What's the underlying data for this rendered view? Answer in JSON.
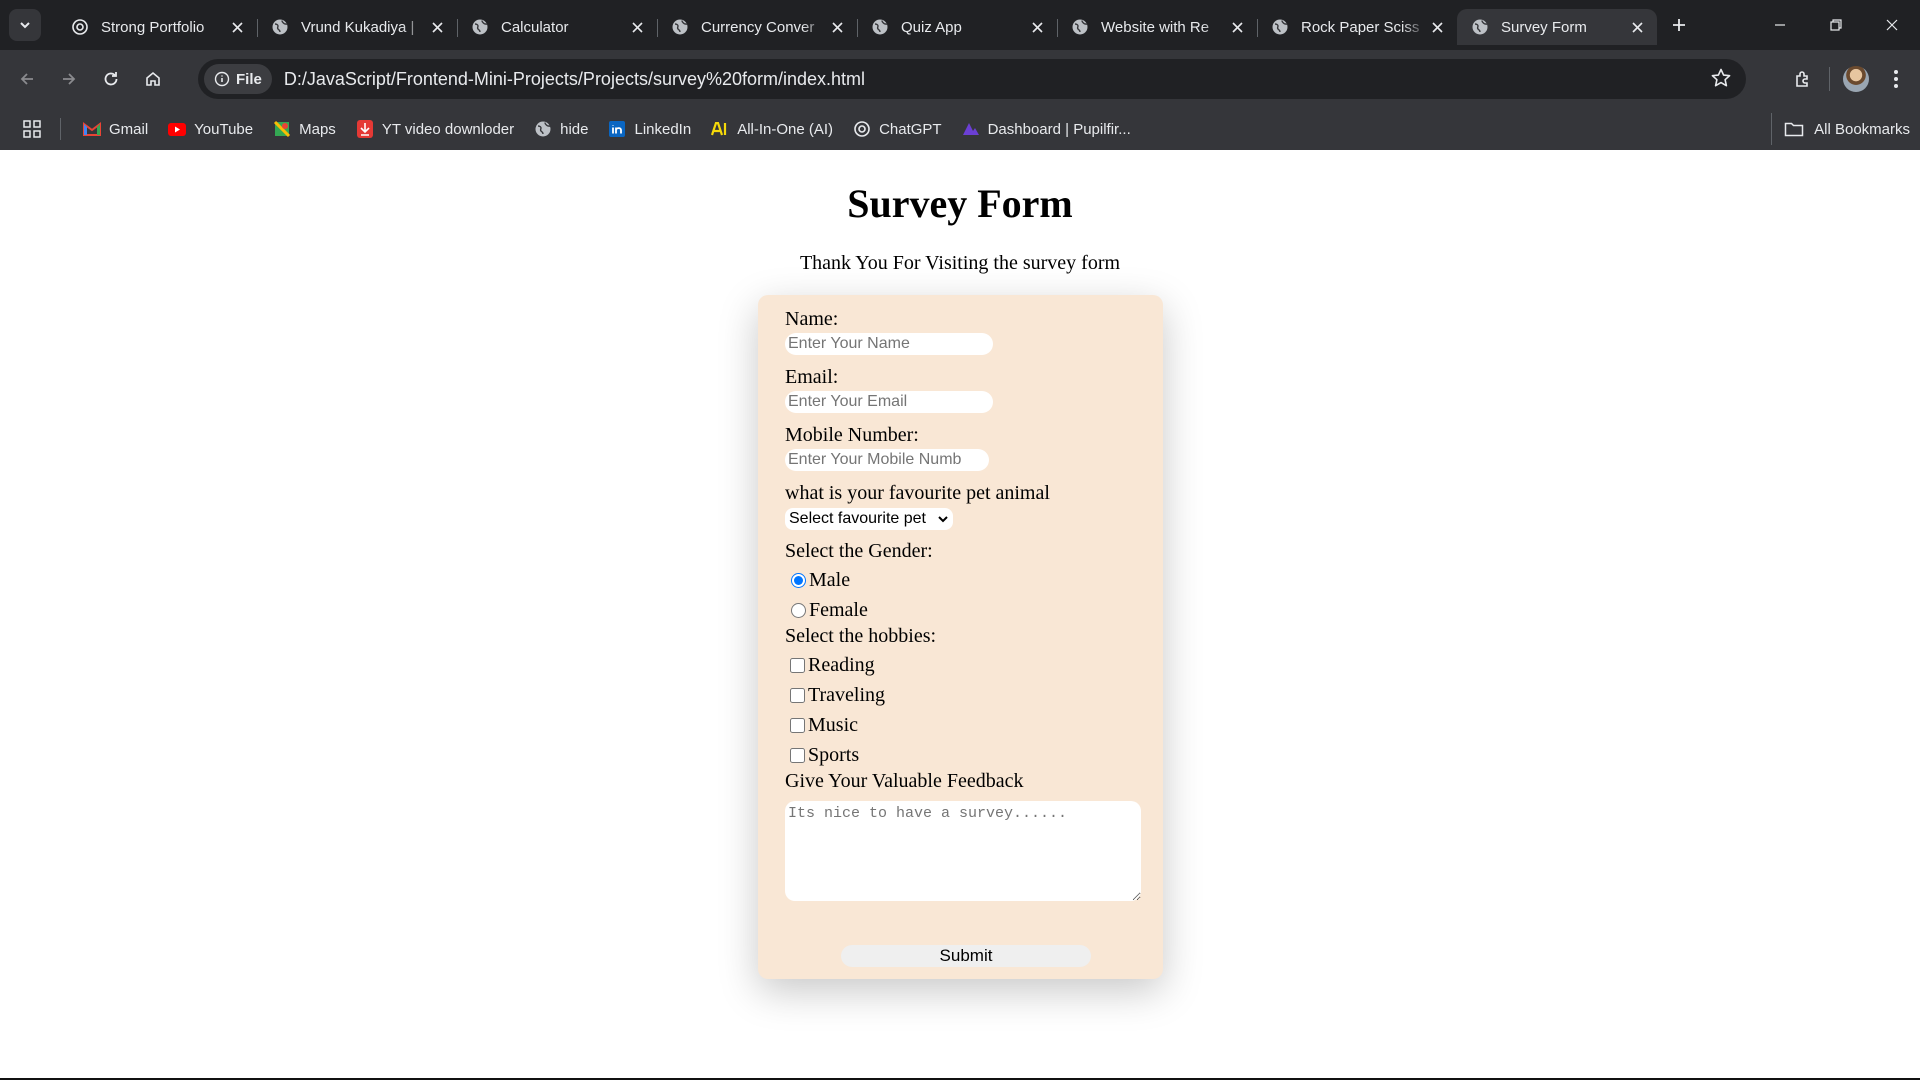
{
  "browser": {
    "tabs": [
      {
        "title": "Strong Portfolio",
        "icon": "openai-icon"
      },
      {
        "title": "Vrund Kukadiya |",
        "icon": "globe-icon"
      },
      {
        "title": "Calculator",
        "icon": "globe-icon"
      },
      {
        "title": "Currency Conver",
        "icon": "globe-icon"
      },
      {
        "title": "Quiz App",
        "icon": "globe-icon"
      },
      {
        "title": "Website with Re",
        "icon": "globe-icon"
      },
      {
        "title": "Rock Paper Sciss",
        "icon": "globe-icon"
      },
      {
        "title": "Survey Form",
        "icon": "globe-icon",
        "active": true
      }
    ],
    "address": {
      "chip": "File",
      "url": "D:/JavaScript/Frontend-Mini-Projects/Projects/survey%20form/index.html"
    },
    "bookmarks": [
      {
        "label": "Gmail",
        "icon": "gmail-icon",
        "color": "#ea4335"
      },
      {
        "label": "YouTube",
        "icon": "youtube-icon",
        "color": "#ff0000"
      },
      {
        "label": "Maps",
        "icon": "maps-icon",
        "color": "#34a853"
      },
      {
        "label": "YT video downloder",
        "icon": "download-icon",
        "color": "#e53935"
      },
      {
        "label": "hide",
        "icon": "globe-icon",
        "color": "#e8eaed"
      },
      {
        "label": "LinkedIn",
        "icon": "linkedin-icon",
        "color": "#0a66c2"
      },
      {
        "label": "All-In-One (AI)",
        "icon": "ai-icon",
        "color": "#f5d90a"
      },
      {
        "label": "ChatGPT",
        "icon": "openai-icon",
        "color": "#e8eaed"
      },
      {
        "label": "Dashboard | Pupilfir...",
        "icon": "dashboard-icon",
        "color": "#6b3fd4"
      }
    ],
    "all_bookmarks": "All Bookmarks"
  },
  "page": {
    "title": "Survey Form",
    "subtitle": "Thank You For Visiting the survey form",
    "form": {
      "name_label": "Name:",
      "name_placeholder": "Enter Your Name",
      "email_label": "Email:",
      "email_placeholder": "Enter Your Email",
      "mobile_label": "Mobile Number:",
      "mobile_placeholder": "Enter Your Mobile Numb",
      "pet_label": "what is your favourite pet animal",
      "pet_selected": "Select favourite pet",
      "gender_label": "Select the Gender:",
      "gender_options": [
        {
          "label": "Male",
          "checked": true
        },
        {
          "label": "Female",
          "checked": false
        }
      ],
      "hobbies_label": "Select the hobbies:",
      "hobbies": [
        {
          "label": "Reading",
          "checked": false
        },
        {
          "label": "Traveling",
          "checked": false
        },
        {
          "label": "Music",
          "checked": false
        },
        {
          "label": "Sports",
          "checked": false
        }
      ],
      "feedback_label": "Give Your Valuable Feedback",
      "feedback_placeholder": "Its nice to have a survey......",
      "submit_label": "Submit",
      "card_color": "#f9e7d5"
    }
  }
}
